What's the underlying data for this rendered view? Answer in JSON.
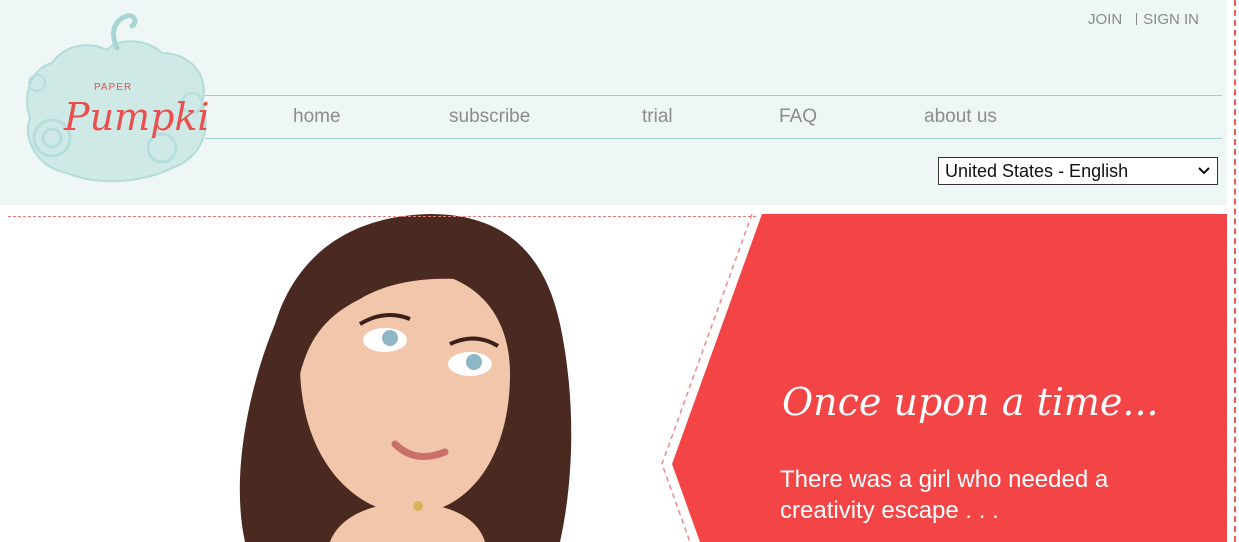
{
  "brand": {
    "logo_text_small": "PAPER",
    "logo_text_big": "Pumpkin"
  },
  "top_links": {
    "join": "JOIN",
    "sign_in": "SIGN IN"
  },
  "nav": {
    "items": [
      {
        "label": "home"
      },
      {
        "label": "subscribe"
      },
      {
        "label": "trial"
      },
      {
        "label": "FAQ"
      },
      {
        "label": "about us"
      }
    ]
  },
  "locale_select": {
    "selected": "United States - English"
  },
  "hero": {
    "headline": "Once upon a time...",
    "subline": "There was a girl who needed a creativity escape . . ."
  },
  "colors": {
    "header_bg": "#eef7f6",
    "accent_red": "#f44546",
    "nav_text": "#8c8c8c",
    "logo_teal": "#bfe3e1"
  }
}
